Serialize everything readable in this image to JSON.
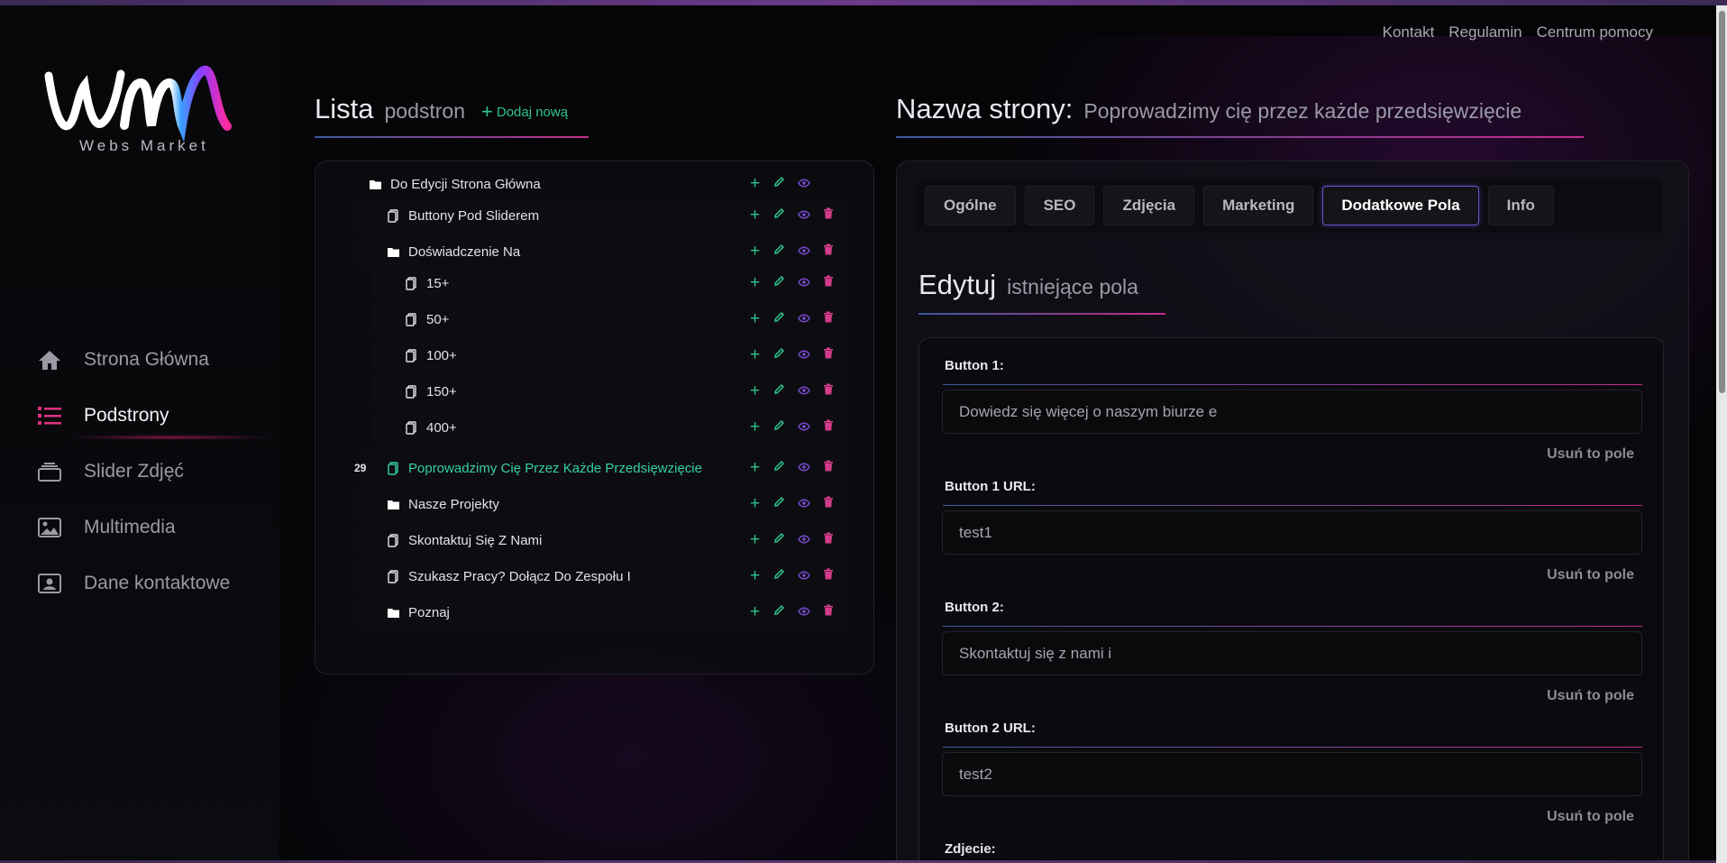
{
  "top_nav": [
    "Kontakt",
    "Regulamin",
    "Centrum pomocy"
  ],
  "logo": {
    "text": "Webs Market"
  },
  "sidebar": {
    "items": [
      {
        "label": "Strona Główna",
        "icon": "home-icon",
        "active": false
      },
      {
        "label": "Podstrony",
        "icon": "list-icon",
        "active": true
      },
      {
        "label": "Slider Zdjęć",
        "icon": "layers-icon",
        "active": false
      },
      {
        "label": "Multimedia",
        "icon": "image-icon",
        "active": false
      },
      {
        "label": "Dane kontaktowe",
        "icon": "contact-card-icon",
        "active": false
      }
    ]
  },
  "list_section": {
    "title": "Lista",
    "subtitle": "podstron",
    "add_label": "Dodaj nową"
  },
  "tree": [
    {
      "label": "Do Edycji Strona Główna",
      "type": "folder",
      "level": 0,
      "deletable": false
    },
    {
      "label": "Buttony Pod Sliderem",
      "type": "page",
      "level": 1,
      "deletable": true
    },
    {
      "label": "Doświadczenie Na",
      "type": "folder",
      "level": 1,
      "deletable": true
    },
    {
      "label": "15+",
      "type": "page",
      "level": 2,
      "deletable": true
    },
    {
      "label": "50+",
      "type": "page",
      "level": 2,
      "deletable": true
    },
    {
      "label": "100+",
      "type": "page",
      "level": 2,
      "deletable": true
    },
    {
      "label": "150+",
      "type": "page",
      "level": 2,
      "deletable": true
    },
    {
      "label": "400+",
      "type": "page",
      "level": 2,
      "deletable": true
    },
    {
      "label": "Poprowadzimy Cię Przez Każde Przedsięwzięcie",
      "type": "page",
      "level": 1,
      "deletable": true,
      "highlight": true,
      "number": "29"
    },
    {
      "label": "Nasze Projekty",
      "type": "folder",
      "level": 1,
      "deletable": true
    },
    {
      "label": "Skontaktuj Się Z Nami",
      "type": "page",
      "level": 1,
      "deletable": true
    },
    {
      "label": "Szukasz Pracy? Dołącz Do Zespołu I",
      "type": "page",
      "level": 1,
      "deletable": true
    },
    {
      "label": "Poznaj",
      "type": "folder",
      "level": 1,
      "deletable": true
    }
  ],
  "page_name": {
    "label": "Nazwa strony:",
    "value": "Poprowadzimy cię przez każde przedsięwzięcie"
  },
  "tabs": [
    {
      "label": "Ogólne",
      "active": false
    },
    {
      "label": "SEO",
      "active": false
    },
    {
      "label": "Zdjęcia",
      "active": false
    },
    {
      "label": "Marketing",
      "active": false
    },
    {
      "label": "Dodatkowe Pola",
      "active": true
    },
    {
      "label": "Info",
      "active": false
    }
  ],
  "edit_section": {
    "title": "Edytuj",
    "subtitle": "istniejące pola"
  },
  "fields": [
    {
      "label": "Button 1:",
      "value": "Dowiedz się więcej o naszym biurze e",
      "remove": "Usuń to pole"
    },
    {
      "label": "Button 1 URL:",
      "value": "test1",
      "remove": "Usuń to pole"
    },
    {
      "label": "Button 2:",
      "value": "Skontaktuj się z nami i",
      "remove": "Usuń to pole"
    },
    {
      "label": "Button 2 URL:",
      "value": "test2",
      "remove": "Usuń to pole"
    },
    {
      "label": "Zdjecie:",
      "value": "",
      "remove": ""
    }
  ],
  "colors": {
    "accent_green": "#2fc38f",
    "accent_pink": "#d23c8a",
    "accent_purple": "#7a4ad0",
    "active_tab_border": "#6f4fd0"
  }
}
